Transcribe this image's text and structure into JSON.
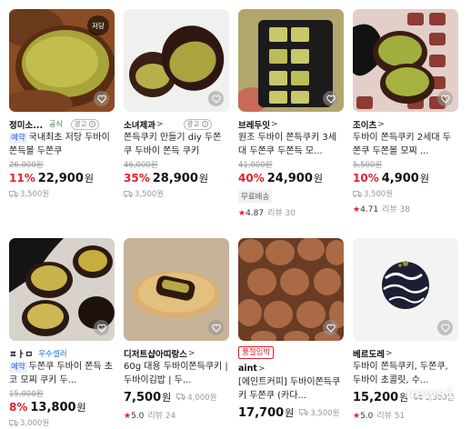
{
  "products": [
    {
      "badge": "저당",
      "store": "정미소...",
      "store_chevron": ">",
      "official": "공식",
      "ad": "광고",
      "early_tag": "예약",
      "title": "국내최초 저당 두바이 쫀득볼 두쫀쿠",
      "original_price": "26,000원",
      "discount": "11%",
      "price": "22,900",
      "won": "원",
      "shipping": "3,500원"
    },
    {
      "store": "소녀제과",
      "store_chevron": ">",
      "ad": "광고",
      "title": "쫀득쿠키 만들기 diy 두쫀쿠 두바이 쫀득 쿠키",
      "original_price": "46,000원",
      "discount": "35%",
      "price": "28,900",
      "won": "원",
      "shipping": "3,500원"
    },
    {
      "store": "브레두잇",
      "store_chevron": ">",
      "title": "원조 두바이 쫀득쿠키 3세대 두쫀쿠 두쫀득 모...",
      "original_price": "41,000원",
      "discount": "40%",
      "price": "24,900",
      "won": "원",
      "free_shipping": "무료배송",
      "rating": "4.87",
      "review": "리뷰 30"
    },
    {
      "store": "조이츠",
      "store_chevron": ">",
      "title": "두바이 쫀득쿠키 2세대 두쫀쿠 두쫀볼 모찌 ...",
      "original_price": "5,500원",
      "discount": "10%",
      "price": "4,900",
      "won": "원",
      "shipping": "3,500원",
      "rating": "4.71",
      "review": "리뷰 38"
    },
    {
      "store": "ㅍㅏㅁ",
      "official": "우수셀러",
      "early_tag": "예약",
      "title": "두쫀쿠 두바이 쫀득 초코 모찌 쿠키 두...",
      "original_price": "15,000원",
      "discount": "8%",
      "price": "13,800",
      "won": "원",
      "shipping": "3,000원"
    },
    {
      "store": "디저트샵아띠랑스",
      "store_chevron": ">",
      "title": "60g 대용 두바이쫀득쿠키 | 두바이김밥 | 두...",
      "price": "7,500",
      "won": "원",
      "shipping": "4,000원",
      "rating": "5.0",
      "review": "리뷰 24"
    },
    {
      "label": "품절임박",
      "store": "aint",
      "store_chevron": ">",
      "title": "[에인트커피] 두바이쫀득쿠키 두쫀쿠 (카다...",
      "price": "17,700",
      "won": "원",
      "shipping": "3,500원"
    },
    {
      "store": "베르도레",
      "store_chevron": ">",
      "title": "두바이 쫀득쿠키, 두쫀쿠, 두바이 초콜릿, 수...",
      "price": "15,200",
      "won": "원",
      "shipping": "3,500원",
      "rating": "5.0",
      "review": "리뷰 51"
    }
  ],
  "watermark": "news1",
  "icons": {
    "heart": "heart-icon",
    "truck": "truck-icon",
    "star": "star-icon"
  },
  "colors": {
    "discount": "#e0212e",
    "official": "#2f7d3b",
    "early_tag": "#2a62d6",
    "seller": "#1e6fd9"
  }
}
